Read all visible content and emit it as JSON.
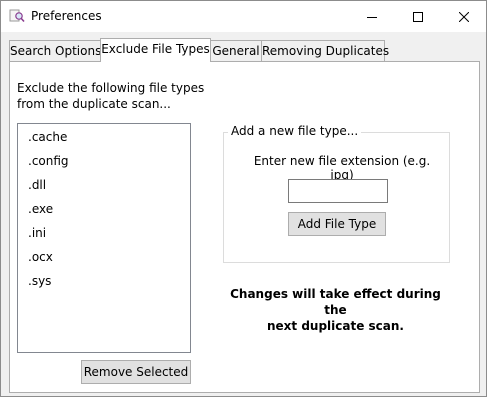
{
  "window": {
    "title": "Preferences",
    "icon": "preferences-magnifier-icon",
    "controls": [
      "minimize",
      "maximize",
      "close"
    ]
  },
  "tabs": [
    {
      "label": "Search Options",
      "active": false
    },
    {
      "label": "Exclude File Types",
      "active": true
    },
    {
      "label": "General",
      "active": false
    },
    {
      "label": "Removing Duplicates",
      "active": false
    }
  ],
  "exclude": {
    "instructions_line1": "Exclude the following file types",
    "instructions_line2": "from the duplicate scan...",
    "file_types": [
      ".cache",
      ".config",
      ".dll",
      ".exe",
      ".ini",
      ".ocx",
      ".sys"
    ],
    "remove_button": "Remove Selected"
  },
  "add_group": {
    "title": "Add a new file type...",
    "prompt": "Enter new file extension (e.g. jpg)",
    "input_value": "",
    "add_button": "Add File Type"
  },
  "notice": {
    "line1": "Changes will take effect during the",
    "line2": "next duplicate scan."
  }
}
